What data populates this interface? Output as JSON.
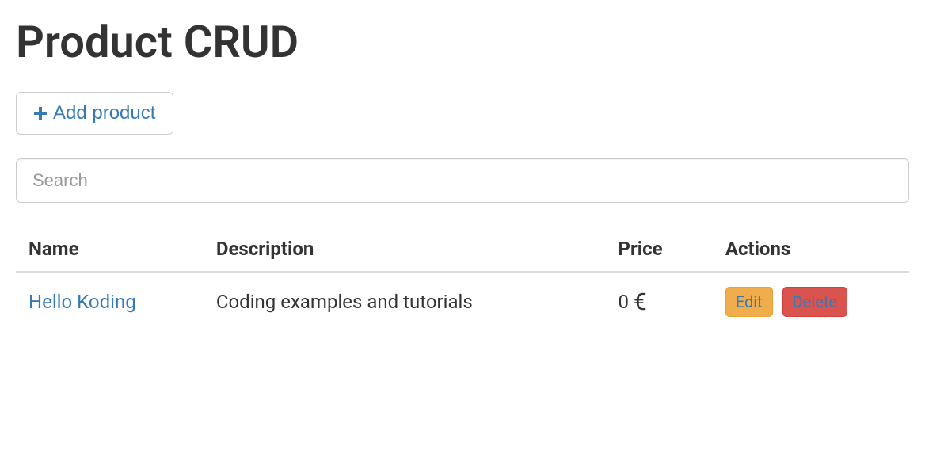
{
  "page": {
    "title": "Product CRUD"
  },
  "toolbar": {
    "add_product_label": "Add product"
  },
  "search": {
    "placeholder": "Search",
    "value": ""
  },
  "table": {
    "columns": {
      "name": "Name",
      "description": "Description",
      "price": "Price",
      "actions": "Actions"
    },
    "rows": [
      {
        "name": "Hello Koding",
        "description": "Coding examples and tutorials",
        "price": "0",
        "currency_symbol": "€",
        "edit_label": "Edit",
        "delete_label": "Delete"
      }
    ]
  }
}
